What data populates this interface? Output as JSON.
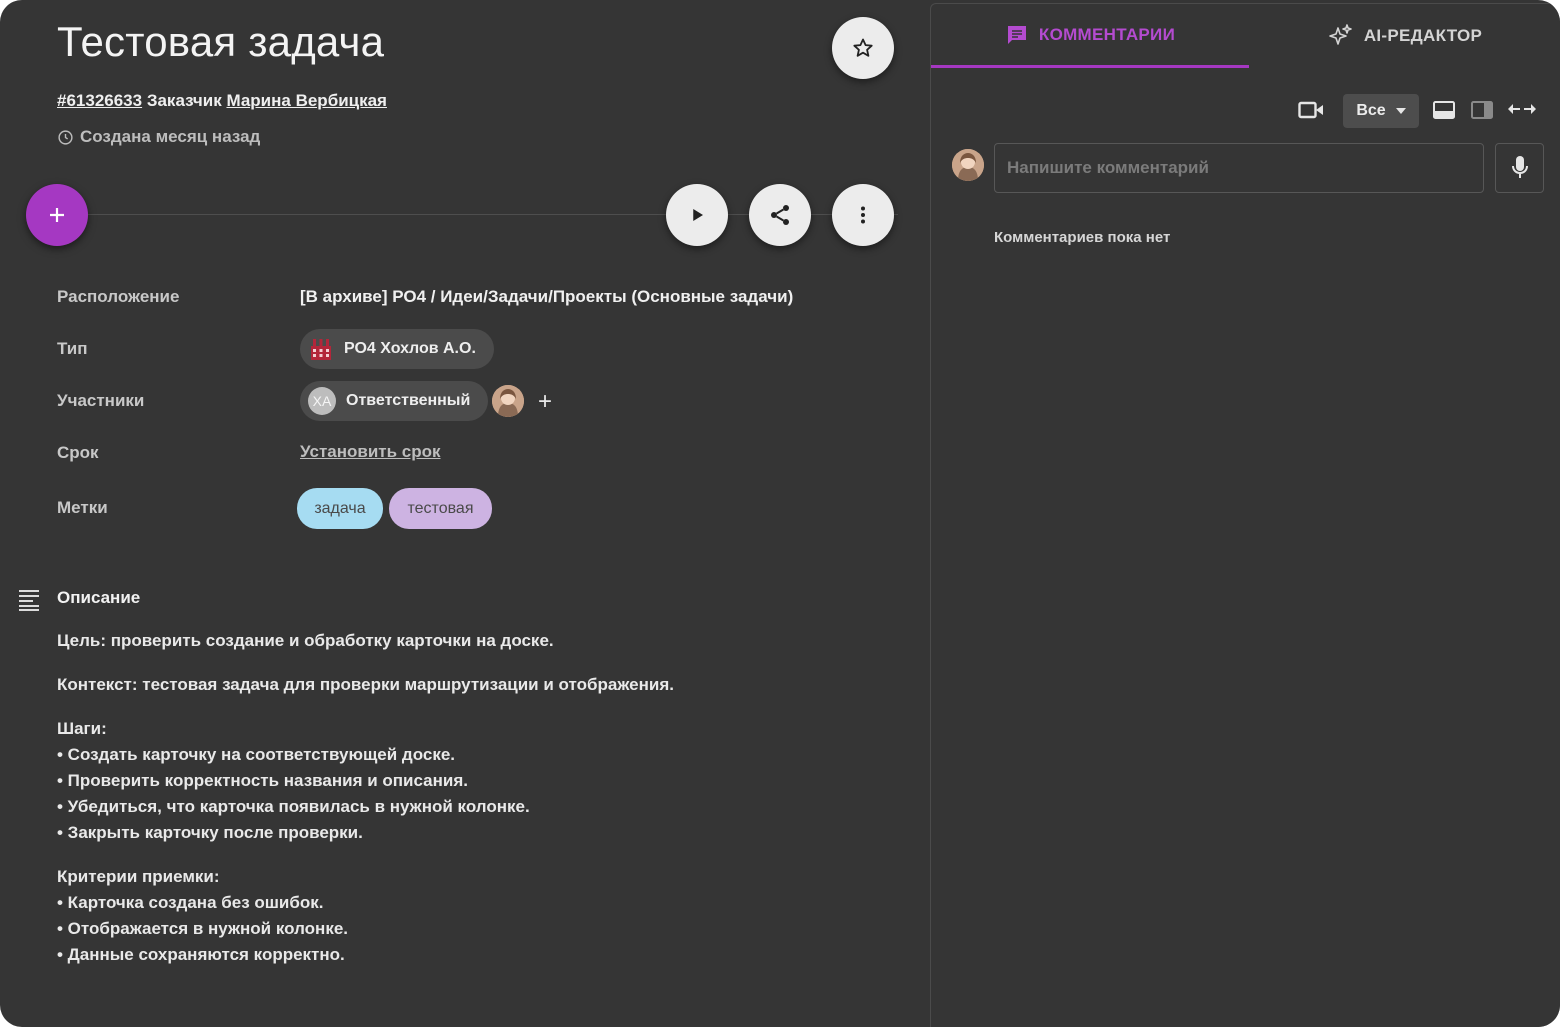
{
  "task": {
    "title": "Тестовая задача",
    "id_link": "#61326633",
    "customer_label": "Заказчик",
    "customer_name": "Марина Вербицкая",
    "created": "Создана месяц назад"
  },
  "icons": {
    "star": "star-icon",
    "play": "play-icon",
    "share": "share-icon",
    "more": "more-vert-icon",
    "add": "plus-icon",
    "clock": "clock-icon",
    "description": "notes-icon"
  },
  "properties": {
    "location_label": "Расположение",
    "location_value": "[В архиве] РО4 / Идеи/Задачи/Проекты (Основные задачи)",
    "type_label": "Тип",
    "type_value": "РО4 Хохлов А.О.",
    "participants_label": "Участники",
    "participant_initials": "ХА",
    "participant_role": "Ответственный",
    "add_participant": "+",
    "due_label": "Срок",
    "due_link": "Установить срок",
    "tags_label": "Метки",
    "tags": [
      {
        "label": "задача",
        "color": "#a6dcf2"
      },
      {
        "label": "тестовая",
        "color": "#cdb3e2"
      }
    ]
  },
  "description": {
    "title": "Описание",
    "goal": "Цель: проверить создание и обработку карточки на доске.",
    "context": "Контекст: тестовая задача для проверки маршрутизации и отображения.",
    "steps_title": "Шаги:",
    "steps": [
      "• Создать карточку на соответствующей доске.",
      "• Проверить корректность названия и описания.",
      "• Убедиться, что карточка появилась в нужной колонке.",
      "• Закрыть карточку после проверки."
    ],
    "criteria_title": "Критерии приемки:",
    "criteria": [
      "• Карточка создана без ошибок.",
      "• Отображается в нужной колонке.",
      "• Данные сохраняются корректно."
    ]
  },
  "comments_panel": {
    "tab_comments": "КОММЕНТАРИИ",
    "tab_ai": "AI-РЕДАКТОР",
    "filter_value": "Все",
    "input_placeholder": "Напишите комментарий",
    "empty_text": "Комментариев пока нет"
  },
  "colors": {
    "accent": "#a538c2",
    "background": "#353535"
  }
}
